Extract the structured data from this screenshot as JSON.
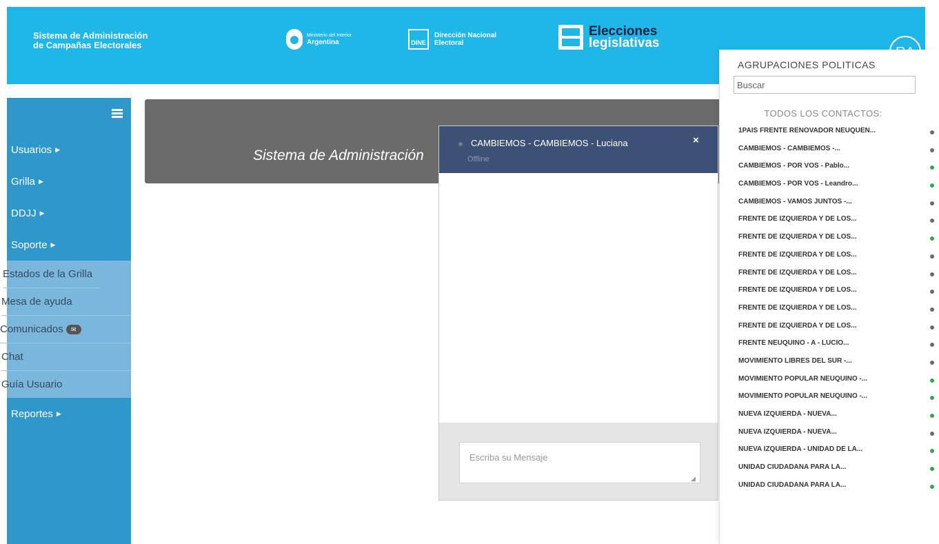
{
  "header": {
    "brand_line1": "Sistema de Administración",
    "brand_line2": "de Campañas Electorales",
    "ministerio_small": "Ministerio del Interior",
    "ministerio_big": "Argentina",
    "dine_box": "DINE",
    "dine_line1": "Dirección Nacional",
    "dine_line2": "Electoral",
    "elecciones_line1": "Elecciones",
    "elecciones_line2": "legislativas",
    "avatar": "RA",
    "color": "#1fb6e8"
  },
  "sidebar": {
    "menu": [
      {
        "label": "Usuarios"
      },
      {
        "label": "Grilla"
      },
      {
        "label": "DDJJ"
      },
      {
        "label": "Soporte"
      }
    ],
    "submenu": [
      {
        "label": "Estados de la Grilla"
      },
      {
        "label": "Mesa de ayuda"
      },
      {
        "label": "Comunicados"
      },
      {
        "label": "Chat"
      },
      {
        "label": "Guía Usuario"
      }
    ],
    "reportes": "Reportes",
    "icons": {
      "caret": "caret-right-icon",
      "menu": "hamburger-menu-icon",
      "badge": "message-badge-icon"
    }
  },
  "banner": {
    "text": "Sistema de Administración"
  },
  "chat": {
    "title": "CAMBIEMOS - CAMBIEMOS - Luciana",
    "status": "Offline",
    "close": "×",
    "input_placeholder": "Escriba su Mensaje",
    "header_color": "#3d5177"
  },
  "contacts": {
    "title": "AGRUPACIONES POLITICAS",
    "search_placeholder": "Buscar",
    "subtitle": "TODOS LOS CONTACTOS:",
    "status_colors": {
      "online": "#2fa84f",
      "offline": "#6b6b6b"
    },
    "list": [
      {
        "name": "1PAIS FRENTE RENOVADOR NEUQUEN...",
        "status": "offline"
      },
      {
        "name": "CAMBIEMOS - CAMBIEMOS -...",
        "status": "offline"
      },
      {
        "name": "CAMBIEMOS - POR VOS - Pablo...",
        "status": "online"
      },
      {
        "name": "CAMBIEMOS - POR VOS - Leandro...",
        "status": "online"
      },
      {
        "name": "CAMBIEMOS - VAMOS JUNTOS -...",
        "status": "offline"
      },
      {
        "name": "FRENTE DE IZQUIERDA Y DE LOS...",
        "status": "offline"
      },
      {
        "name": "FRENTE DE IZQUIERDA Y DE LOS...",
        "status": "online"
      },
      {
        "name": "FRENTE DE IZQUIERDA Y DE LOS...",
        "status": "offline"
      },
      {
        "name": "FRENTE DE IZQUIERDA Y DE LOS...",
        "status": "offline"
      },
      {
        "name": "FRENTE DE IZQUIERDA Y DE LOS...",
        "status": "offline"
      },
      {
        "name": "FRENTE DE IZQUIERDA Y DE LOS...",
        "status": "offline"
      },
      {
        "name": "FRENTE DE IZQUIERDA Y DE LOS...",
        "status": "offline"
      },
      {
        "name": "FRENTE NEUQUINO - A - LUCIO...",
        "status": "offline"
      },
      {
        "name": "MOVIMIENTO LIBRES DEL SUR -...",
        "status": "offline"
      },
      {
        "name": "MOVIMIENTO POPULAR NEUQUINO -...",
        "status": "online"
      },
      {
        "name": "MOVIMIENTO POPULAR NEUQUINO -...",
        "status": "online"
      },
      {
        "name": "NUEVA IZQUIERDA - NUEVA...",
        "status": "online"
      },
      {
        "name": "NUEVA IZQUIERDA - NUEVA...",
        "status": "offline"
      },
      {
        "name": "NUEVA IZQUIERDA - UNIDAD DE LA...",
        "status": "online"
      },
      {
        "name": "UNIDAD CIUDADANA PARA LA...",
        "status": "online"
      },
      {
        "name": "UNIDAD CIUDADANA PARA LA...",
        "status": "online"
      }
    ]
  }
}
